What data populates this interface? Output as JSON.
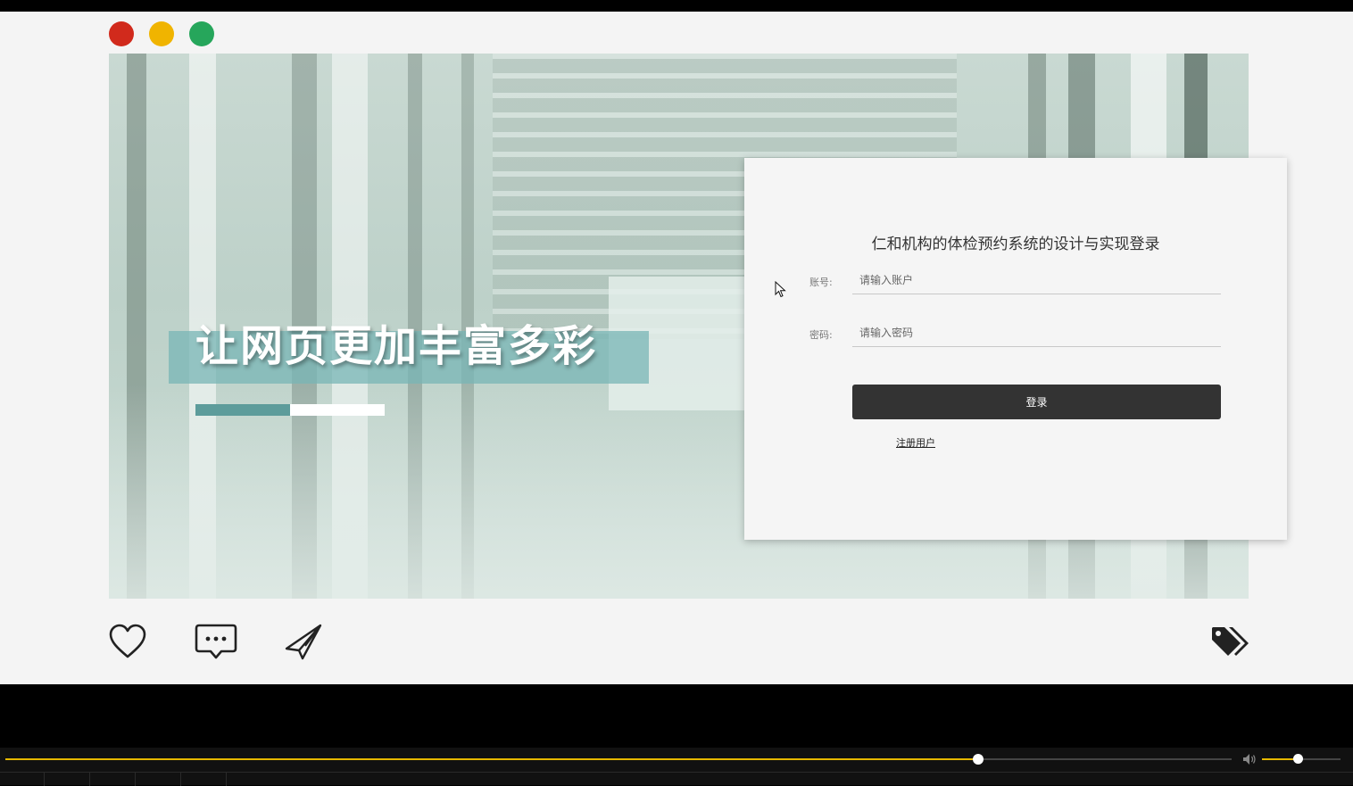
{
  "window": {
    "controls": [
      "close",
      "minimize",
      "maximize"
    ],
    "colors": {
      "close": "#d12a1c",
      "minimize": "#f0b400",
      "maximize": "#26a65b"
    }
  },
  "hero": {
    "headline": "让网页更加丰富多彩",
    "accent_color": "#5d9c9b"
  },
  "login": {
    "title": "仁和机构的体检预约系统的设计与实现登录",
    "account_label": "账号:",
    "account_placeholder": "请输入账户",
    "account_value": "",
    "password_label": "密码:",
    "password_placeholder": "请输入密码",
    "password_value": "",
    "submit_label": "登录",
    "register_label": "注册用户"
  },
  "social_icons": [
    "heart-icon",
    "comment-icon",
    "send-icon",
    "tag-icon"
  ],
  "player": {
    "progress": 0.793,
    "volume": 0.45,
    "accent": "#e6b800"
  }
}
